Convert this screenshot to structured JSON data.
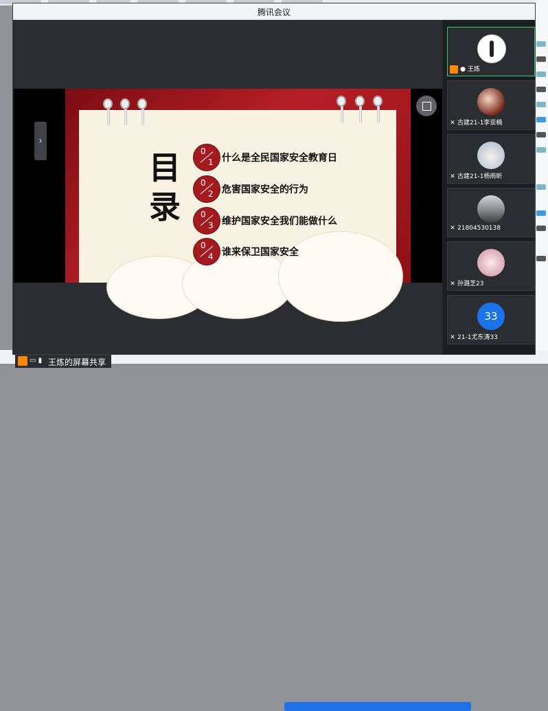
{
  "window": {
    "title": "腾讯会议"
  },
  "slide": {
    "heading_line1": "目",
    "heading_line2": "录",
    "items": [
      {
        "d1": "0",
        "d2": "1",
        "text": "什么是全民国家安全教育日"
      },
      {
        "d1": "0",
        "d2": "2",
        "text": "危害国家安全的行为"
      },
      {
        "d1": "0",
        "d2": "3",
        "text": "维护国家安全我们能做什么"
      },
      {
        "d1": "0",
        "d2": "4",
        "text": "谁来保卫国家安全"
      }
    ]
  },
  "share": {
    "label": "王炼的屏幕共享"
  },
  "participants": [
    {
      "name": "王炼",
      "host": true,
      "mic": "on"
    },
    {
      "name": "古建21-1李亚楠",
      "mic": "muted"
    },
    {
      "name": "古建21-1杨雨昕",
      "mic": "muted"
    },
    {
      "name": "21804530138",
      "mic": "muted"
    },
    {
      "name": "孙潞芝23",
      "mic": "muted"
    },
    {
      "name": "21-1尤东涛33",
      "mic": "muted",
      "avatar_text": "33"
    }
  ],
  "colors": {
    "accent": "#1a73e8",
    "active_border": "#2ecc71",
    "slide_red": "#a31a1f"
  }
}
